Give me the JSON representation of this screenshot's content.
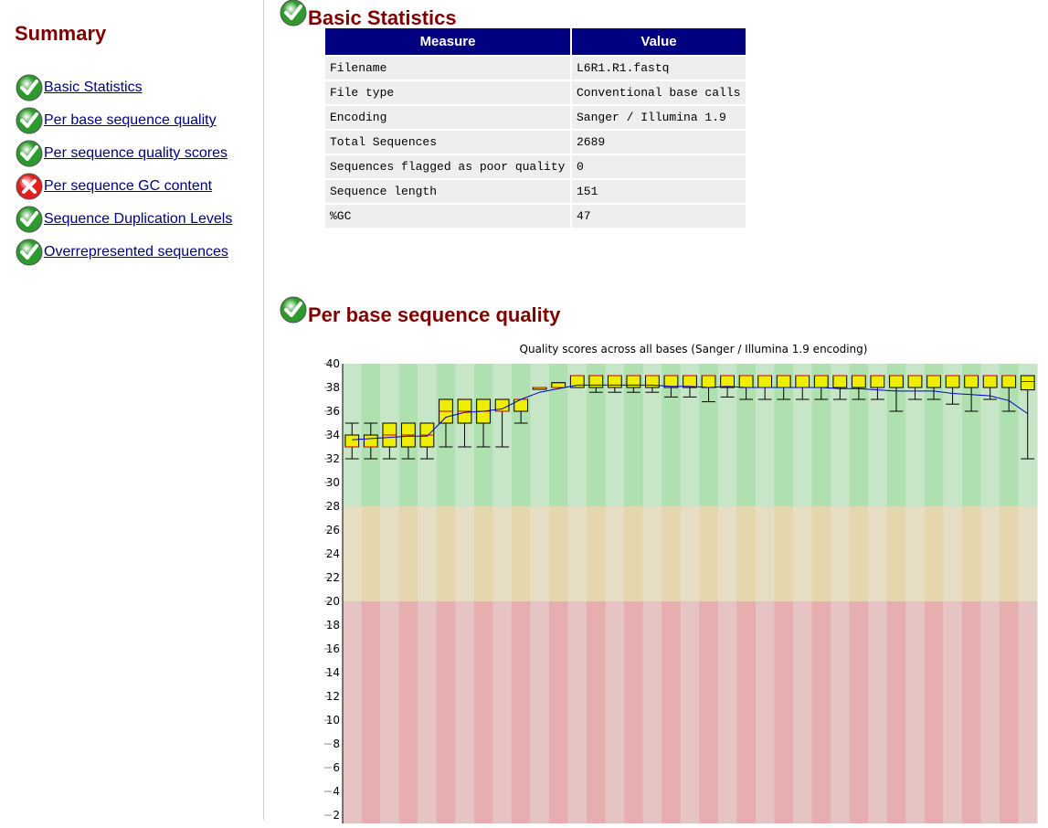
{
  "summary": {
    "title": "Summary",
    "items": [
      {
        "label": "Basic Statistics",
        "status": "pass"
      },
      {
        "label": "Per base sequence quality",
        "status": "pass"
      },
      {
        "label": "Per sequence quality scores",
        "status": "pass"
      },
      {
        "label": "Per sequence GC content",
        "status": "fail"
      },
      {
        "label": "Sequence Duplication Levels",
        "status": "pass"
      },
      {
        "label": "Overrepresented sequences",
        "status": "pass"
      }
    ]
  },
  "basic_statistics": {
    "title": "Basic Statistics",
    "status": "pass",
    "header": {
      "measure": "Measure",
      "value": "Value"
    },
    "rows": [
      {
        "measure": "Filename",
        "value": "L6R1.R1.fastq"
      },
      {
        "measure": "File type",
        "value": "Conventional base calls"
      },
      {
        "measure": "Encoding",
        "value": "Sanger / Illumina 1.9"
      },
      {
        "measure": "Total Sequences",
        "value": "2689"
      },
      {
        "measure": "Sequences flagged as poor quality",
        "value": "0"
      },
      {
        "measure": "Sequence length",
        "value": "151"
      },
      {
        "measure": "%GC",
        "value": "47"
      }
    ]
  },
  "per_base_quality": {
    "title": "Per base sequence quality",
    "status": "pass"
  },
  "colors": {
    "heading": "#800000",
    "link": "#000080",
    "table_header": "#000080",
    "pass": "#2e9a2e",
    "fail": "#e02020",
    "box_fill": "#eeee00",
    "mean_line": "#0000cc"
  },
  "chart_data": {
    "type": "box",
    "title": "Quality scores across all bases (Sanger / Illumina 1.9 encoding)",
    "ylim": [
      0,
      40
    ],
    "yticks": [
      2,
      4,
      6,
      8,
      10,
      12,
      14,
      16,
      18,
      20,
      22,
      24,
      26,
      28,
      30,
      32,
      34,
      36,
      38,
      40
    ],
    "zones": [
      {
        "from": 28,
        "to": 40,
        "color": "good"
      },
      {
        "from": 20,
        "to": 28,
        "color": "reasonable"
      },
      {
        "from": 0,
        "to": 20,
        "color": "poor"
      }
    ],
    "boxes": [
      {
        "lower": 33,
        "upper": 34,
        "median": 33,
        "wlow": 32,
        "whigh": 35,
        "mean": 33.6
      },
      {
        "lower": 33,
        "upper": 34,
        "median": 33,
        "wlow": 32,
        "whigh": 35,
        "mean": 33.7
      },
      {
        "lower": 33,
        "upper": 35,
        "median": 34,
        "wlow": 32,
        "whigh": 35,
        "mean": 33.8
      },
      {
        "lower": 33,
        "upper": 35,
        "median": 34,
        "wlow": 32,
        "whigh": 35,
        "mean": 33.9
      },
      {
        "lower": 33,
        "upper": 35,
        "median": 34,
        "wlow": 32,
        "whigh": 35,
        "mean": 33.9
      },
      {
        "lower": 35,
        "upper": 37,
        "median": 36,
        "wlow": 33,
        "whigh": 37,
        "mean": 35.5
      },
      {
        "lower": 35,
        "upper": 37,
        "median": 36,
        "wlow": 33,
        "whigh": 37,
        "mean": 35.9
      },
      {
        "lower": 35,
        "upper": 37,
        "median": 36,
        "wlow": 33,
        "whigh": 37,
        "mean": 36.0
      },
      {
        "lower": 36,
        "upper": 37,
        "median": 36,
        "wlow": 33,
        "whigh": 37,
        "mean": 36.2
      },
      {
        "lower": 36,
        "upper": 37,
        "median": 37,
        "wlow": 35,
        "whigh": 37,
        "mean": 37.0
      },
      {
        "lower": 38,
        "upper": 38,
        "median": 38,
        "wlow": 38,
        "whigh": 38,
        "mean": 37.6
      },
      {
        "lower": 38,
        "upper": 38.4,
        "median": 38,
        "wlow": 38,
        "whigh": 38.4,
        "mean": 37.9
      },
      {
        "lower": 38,
        "upper": 39,
        "median": 39,
        "wlow": 38,
        "whigh": 39,
        "mean": 38.2
      },
      {
        "lower": 38,
        "upper": 39,
        "median": 39,
        "wlow": 37.6,
        "whigh": 39,
        "mean": 38.2
      },
      {
        "lower": 38,
        "upper": 39,
        "median": 39,
        "wlow": 37.6,
        "whigh": 39,
        "mean": 38.2
      },
      {
        "lower": 38,
        "upper": 39,
        "median": 39,
        "wlow": 37.6,
        "whigh": 39,
        "mean": 38.2
      },
      {
        "lower": 38,
        "upper": 39,
        "median": 39,
        "wlow": 37.6,
        "whigh": 39,
        "mean": 38.2
      },
      {
        "lower": 38,
        "upper": 39,
        "median": 39,
        "wlow": 37.2,
        "whigh": 39,
        "mean": 38.1
      },
      {
        "lower": 38,
        "upper": 39,
        "median": 39,
        "wlow": 37.2,
        "whigh": 39,
        "mean": 38.1
      },
      {
        "lower": 38,
        "upper": 39,
        "median": 39,
        "wlow": 36.8,
        "whigh": 39,
        "mean": 38.0
      },
      {
        "lower": 38,
        "upper": 39,
        "median": 39,
        "wlow": 37.2,
        "whigh": 39,
        "mean": 38.1
      },
      {
        "lower": 38,
        "upper": 39,
        "median": 39,
        "wlow": 37.0,
        "whigh": 39,
        "mean": 38.0
      },
      {
        "lower": 38,
        "upper": 39,
        "median": 39,
        "wlow": 37.0,
        "whigh": 39,
        "mean": 38.0
      },
      {
        "lower": 38,
        "upper": 39,
        "median": 39,
        "wlow": 37.0,
        "whigh": 39,
        "mean": 38.0
      },
      {
        "lower": 38,
        "upper": 39,
        "median": 39,
        "wlow": 37.0,
        "whigh": 39,
        "mean": 38.0
      },
      {
        "lower": 38,
        "upper": 39,
        "median": 39,
        "wlow": 37.0,
        "whigh": 39,
        "mean": 38.0
      },
      {
        "lower": 38,
        "upper": 39,
        "median": 39,
        "wlow": 37.0,
        "whigh": 39,
        "mean": 37.9
      },
      {
        "lower": 38,
        "upper": 39,
        "median": 39,
        "wlow": 37.0,
        "whigh": 39,
        "mean": 37.9
      },
      {
        "lower": 38,
        "upper": 39,
        "median": 39,
        "wlow": 37.0,
        "whigh": 39,
        "mean": 37.8
      },
      {
        "lower": 38,
        "upper": 39,
        "median": 39,
        "wlow": 36.0,
        "whigh": 39,
        "mean": 37.7
      },
      {
        "lower": 38,
        "upper": 39,
        "median": 39,
        "wlow": 37.0,
        "whigh": 39,
        "mean": 37.7
      },
      {
        "lower": 38,
        "upper": 39,
        "median": 39,
        "wlow": 37.0,
        "whigh": 39,
        "mean": 37.7
      },
      {
        "lower": 38,
        "upper": 39,
        "median": 39,
        "wlow": 36.6,
        "whigh": 39,
        "mean": 37.5
      },
      {
        "lower": 38,
        "upper": 39,
        "median": 39,
        "wlow": 36.0,
        "whigh": 39,
        "mean": 37.4
      },
      {
        "lower": 38,
        "upper": 39,
        "median": 39,
        "wlow": 37.0,
        "whigh": 39,
        "mean": 37.3
      },
      {
        "lower": 38,
        "upper": 39,
        "median": 39,
        "wlow": 36.0,
        "whigh": 39,
        "mean": 36.9
      },
      {
        "lower": 37.8,
        "upper": 39,
        "median": 38.5,
        "wlow": 32.0,
        "whigh": 39,
        "mean": 35.8
      }
    ]
  }
}
